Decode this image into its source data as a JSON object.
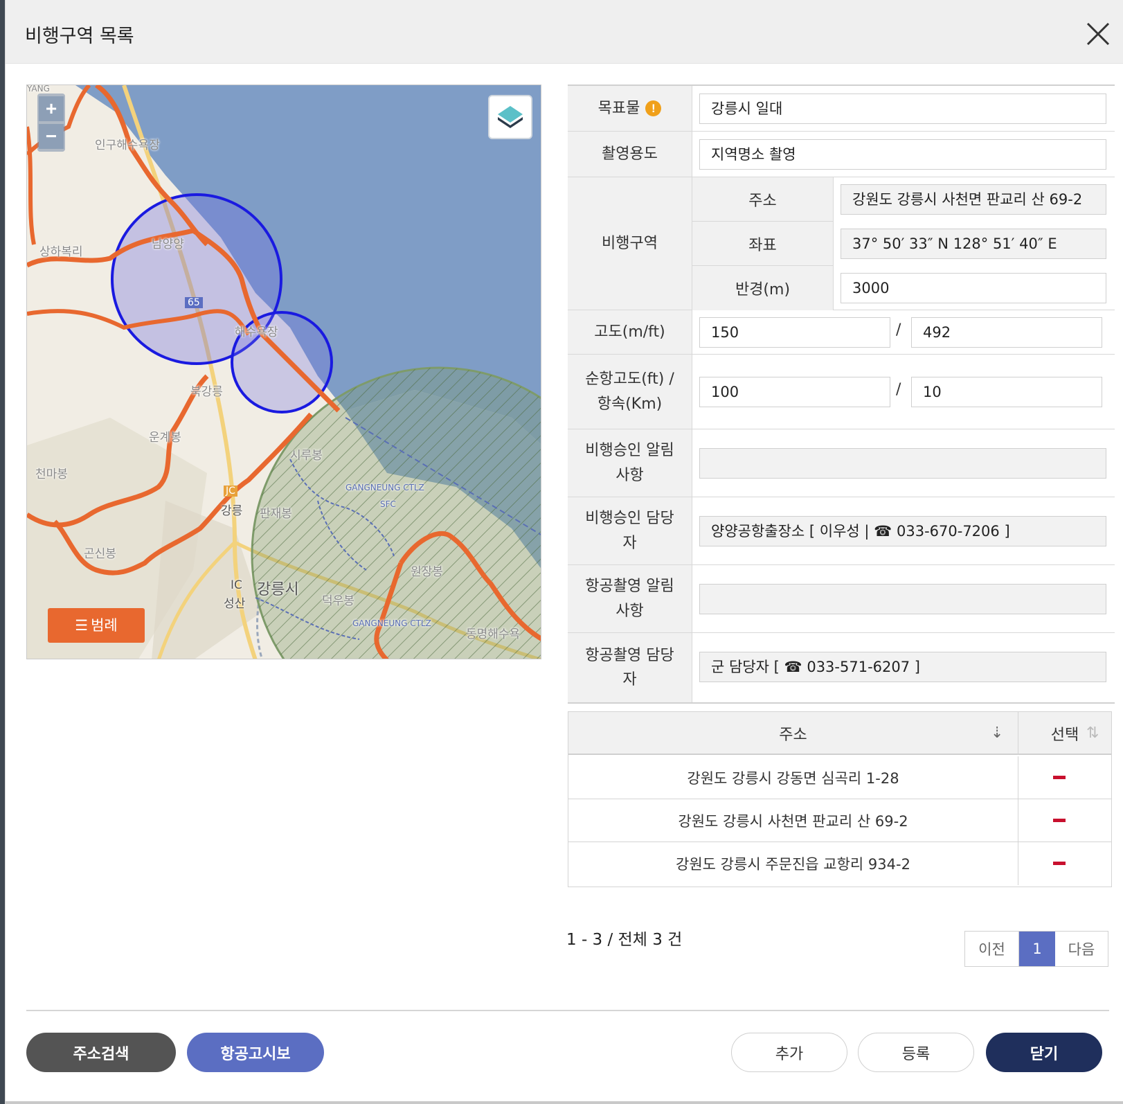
{
  "modal": {
    "title": "비행구역 목록"
  },
  "map": {
    "zoom_in": "+",
    "zoom_out": "−",
    "legend_label": "범례",
    "place_labels": [
      {
        "id": "p1",
        "text": "인구해수욕장"
      },
      {
        "id": "p2",
        "text": "남양양"
      },
      {
        "id": "p3",
        "text": "상하복리"
      },
      {
        "id": "p4",
        "text": "65"
      },
      {
        "id": "p5",
        "text": "북강릉"
      },
      {
        "id": "p6",
        "text": "운계봉"
      },
      {
        "id": "p7",
        "text": "천마봉"
      },
      {
        "id": "p8",
        "text": "강릉"
      },
      {
        "id": "p9",
        "text": "판재봉"
      },
      {
        "id": "p10",
        "text": "시루봉"
      },
      {
        "id": "p11",
        "text": "GANGNEUNG CTLZ"
      },
      {
        "id": "p12",
        "text": "SFC"
      },
      {
        "id": "p13",
        "text": "곤신봉"
      },
      {
        "id": "p14",
        "text": "원장봉"
      },
      {
        "id": "p15",
        "text": "강릉시"
      },
      {
        "id": "p16",
        "text": "성산"
      },
      {
        "id": "p17",
        "text": "덕우봉"
      },
      {
        "id": "p18",
        "text": "동명해수욕"
      },
      {
        "id": "p19",
        "text": "YANG"
      },
      {
        "id": "p20",
        "text": "해수욕장"
      },
      {
        "id": "p21",
        "text": "IC"
      },
      {
        "id": "p22",
        "text": "JC"
      }
    ],
    "colors": {
      "sea": "#7f9dc6",
      "land": "#f1ede4",
      "boundary": "#e8682f",
      "circle_stroke": "#1a1ae0",
      "circle_fill": "#6f6fe0",
      "ctlz_fill": "#7e9b6a"
    }
  },
  "form": {
    "target_label": "목표물",
    "target_value": "강릉시 일대",
    "purpose_label": "촬영용도",
    "purpose_value": "지역명소 촬영",
    "area_label": "비행구역",
    "address_label": "주소",
    "address_value": "강원도 강릉시 사천면 판교리 산 69-2",
    "coord_label": "좌표",
    "coord_value": "37° 50′ 33″ N 128° 51′ 40″ E",
    "radius_label": "반경(m)",
    "radius_value": "3000",
    "altitude_label": "고도(m/ft)",
    "altitude_m": "150",
    "altitude_ft": "492",
    "cruise_label_1": "순항고도(ft) /",
    "cruise_label_2": "항속(Km)",
    "cruise_alt": "100",
    "cruise_speed": "10",
    "flight_notice_label_1": "비행승인 알림",
    "flight_notice_label_2": "사항",
    "flight_notice_value": "",
    "flight_contact_label_1": "비행승인 담당",
    "flight_contact_label_2": "자",
    "flight_contact_value": "양양공항출장소 [ 이우성 | ☎ 033-670-7206 ]",
    "photo_notice_label_1": "항공촬영 알림",
    "photo_notice_label_2": "사항",
    "photo_notice_value": "",
    "photo_contact_label_1": "항공촬영 담당",
    "photo_contact_label_2": "자",
    "photo_contact_value": "군 담당자  [ ☎ 033-571-6207 ]",
    "separator": "/"
  },
  "address_list": {
    "headers": {
      "address": "주소",
      "select": "선택"
    },
    "rows": [
      {
        "address": "강원도 강릉시 강동면 심곡리 1-28"
      },
      {
        "address": "강원도 강릉시 사천면 판교리 산 69-2"
      },
      {
        "address": "강원도 강릉시 주문진읍 교항리 934-2"
      }
    ],
    "count_text": "1 - 3 / 전체 3 건"
  },
  "pagination": {
    "prev": "이전",
    "current": "1",
    "next": "다음"
  },
  "buttons": {
    "search": "주소검색",
    "notam": "항공고시보",
    "add": "추가",
    "register": "등록",
    "close": "닫기"
  }
}
